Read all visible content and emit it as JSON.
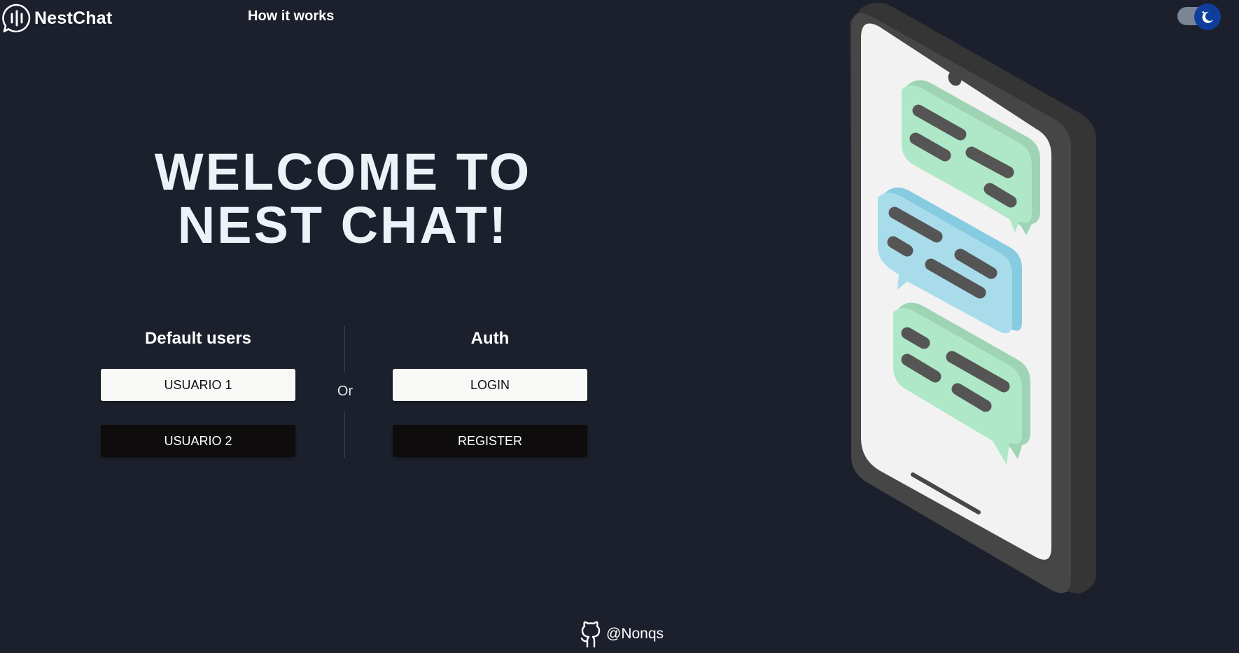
{
  "header": {
    "brand": "NestChat",
    "nav_link": "How it works",
    "theme_toggle_icon": "moon-icon"
  },
  "hero": {
    "title": "WELCOME TO NEST CHAT!"
  },
  "default_users": {
    "heading": "Default users",
    "user1_label": "USUARIO 1",
    "user2_label": "USUARIO 2"
  },
  "separator": {
    "label": "Or"
  },
  "auth": {
    "heading": "Auth",
    "login_label": "LOGIN",
    "register_label": "REGISTER"
  },
  "footer": {
    "handle": "@Nonqs",
    "icon": "github-icon"
  },
  "colors": {
    "background": "#1b202c",
    "toggle_knob": "#0e3d9c",
    "bubble_green": "#aee8c9",
    "bubble_blue": "#a9dceb"
  }
}
